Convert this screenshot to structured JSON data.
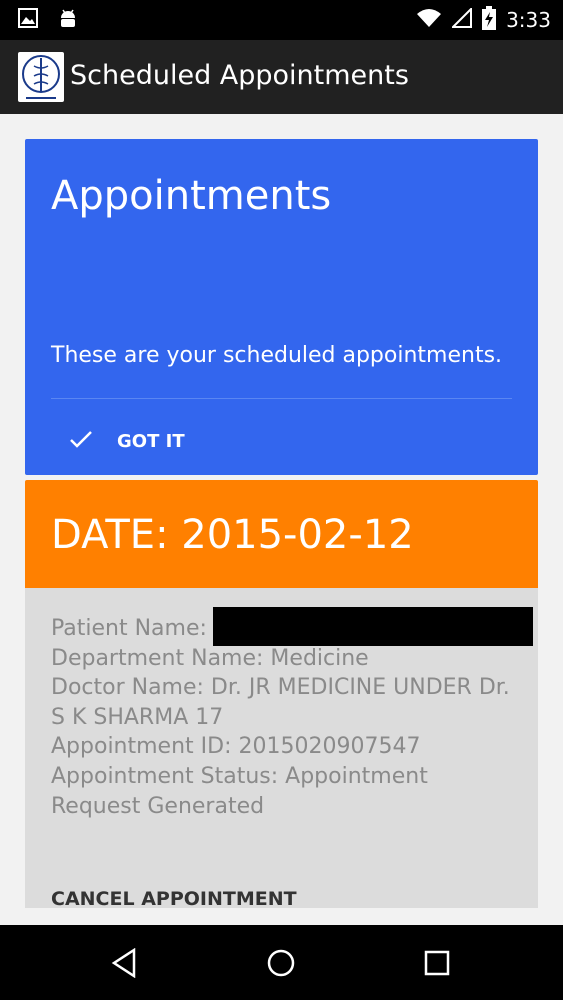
{
  "status_bar": {
    "time": "3:33",
    "icons": [
      "image-icon",
      "android-icon",
      "wifi-icon",
      "signal-icon",
      "battery-charging-icon"
    ]
  },
  "app_bar": {
    "title": "Scheduled Appointments",
    "logo_icon": "caduceus-logo-icon"
  },
  "intro_card": {
    "heading": "Appointments",
    "body": "These are your scheduled appointments.",
    "button_label": "GOT IT",
    "button_icon": "check-icon",
    "color": "#3366ee"
  },
  "appointment": {
    "date_label": "DATE: 2015-02-12",
    "header_color": "#ff8000",
    "patient_name_label": "Patient Name:",
    "department": "Department Name: Medicine",
    "doctor": "Doctor Name: Dr. JR MEDICINE UNDER Dr. S K SHARMA 17",
    "appointment_id": "Appointment ID: 2015020907547",
    "status": "Appointment Status: Appointment Request Generated",
    "cancel_label": "CANCEL APPOINTMENT"
  },
  "nav_bar": {
    "icons": [
      "back-icon",
      "home-icon",
      "recents-icon"
    ]
  }
}
